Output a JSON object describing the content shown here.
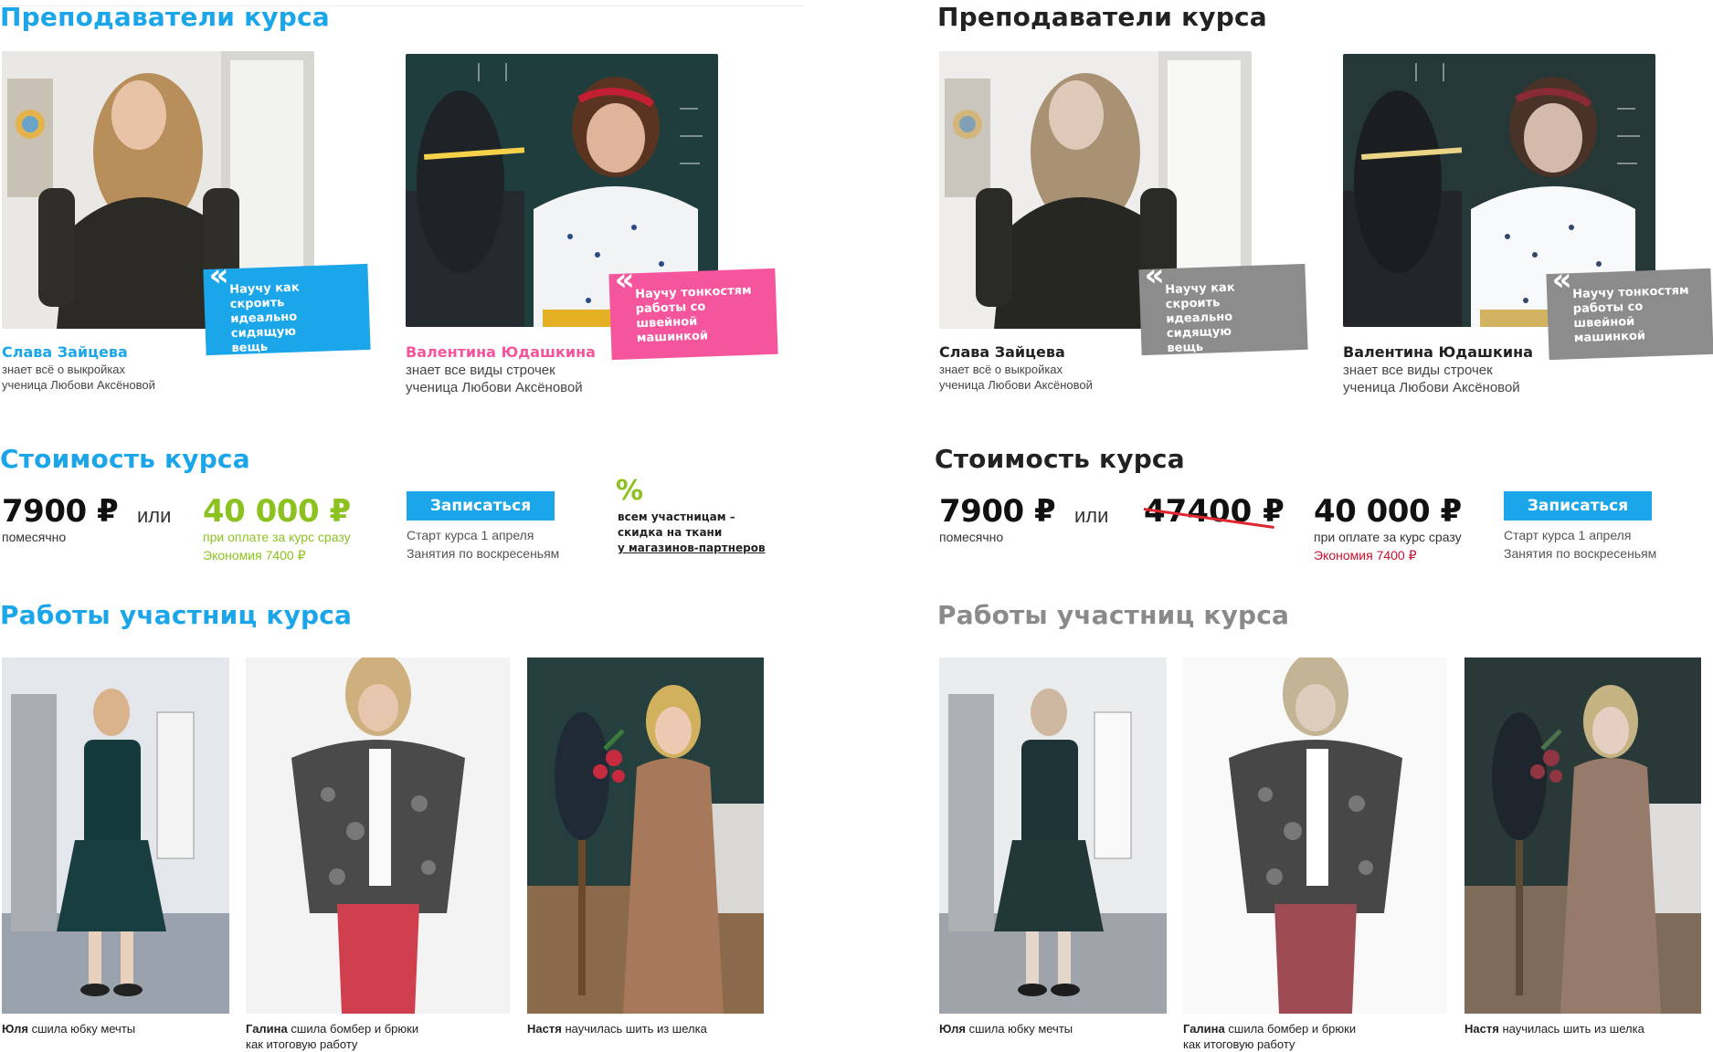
{
  "colors": {
    "blue_accent": "#1ca6ea",
    "pink_accent": "#f5559c",
    "green_accent": "#8cc21f",
    "gray_badge": "#8c8c8c",
    "dark_title": "#222222",
    "gray_title": "#8a8a8a",
    "red_economy": "#c8102e"
  },
  "left": {
    "teachers_title": "Преподаватели курса",
    "teachers": [
      {
        "name": "Слава Зайцева",
        "desc_line1": "знает всё о выкройках",
        "desc_line2": "ученица Любови Аксёновой",
        "quote_line1": "Научу как скроить",
        "quote_line2": "идеально сидящую",
        "quote_line3": "вещь"
      },
      {
        "name": "Валентина Юдашкина",
        "desc_line1": "знает все виды строчек",
        "desc_line2": "ученица Любови Аксёновой",
        "quote_line1": "Научу тонкостям",
        "quote_line2": "работы со швейной",
        "quote_line3": "машинкой"
      }
    ],
    "price_title": "Стоимость курса",
    "monthly_price": "7900 ₽",
    "monthly_label": "помесячно",
    "or_label": "или",
    "full_price": "40 000 ₽",
    "full_label": "при оплате за курс сразу",
    "economy": "Экономия 7400 ₽",
    "signup_label": "Записаться",
    "start_info": "Старт курса 1 апреля",
    "schedule_info": "Занятия по воскресеньям",
    "promo_icon": "%",
    "promo_line1": "всем участницам –",
    "promo_line2": "скидка на ткани",
    "promo_line3": "у магазинов-партнеров",
    "works_title": "Работы участниц курса",
    "works": [
      {
        "author": "Юля",
        "text": "сшила юбку мечты",
        "text2": ""
      },
      {
        "author": "Галина",
        "text": "сшила бомбер и брюки",
        "text2": "как итоговую работу"
      },
      {
        "author": "Настя",
        "text": "научилась шить из шелка",
        "text2": ""
      }
    ]
  },
  "right": {
    "teachers_title": "Преподаватели курса",
    "teachers": [
      {
        "name": "Слава Зайцева",
        "desc_line1": "знает всё о выкройках",
        "desc_line2": "ученица Любови Аксёновой",
        "quote_line1": "Научу как скроить",
        "quote_line2": "идеально сидящую",
        "quote_line3": "вещь"
      },
      {
        "name": "Валентина Юдашкина",
        "desc_line1": "знает все виды строчек",
        "desc_line2": "ученица Любови Аксёновой",
        "quote_line1": "Научу тонкостям",
        "quote_line2": "работы со швейной",
        "quote_line3": "машинкой"
      }
    ],
    "price_title": "Стоимость курса",
    "monthly_price": "7900 ₽",
    "monthly_label": "помесячно",
    "or_label": "или",
    "old_price": "47400 ₽",
    "full_price": "40 000 ₽",
    "full_label": "при оплате за курс сразу",
    "economy": "Экономия 7400 ₽",
    "signup_label": "Записаться",
    "start_info": "Старт курса 1 апреля",
    "schedule_info": "Занятия по воскресеньям",
    "works_title": "Работы участниц курса",
    "works": [
      {
        "author": "Юля",
        "text": "сшила юбку мечты",
        "text2": ""
      },
      {
        "author": "Галина",
        "text": "сшила бомбер и брюки",
        "text2": "как итоговую работу"
      },
      {
        "author": "Настя",
        "text": "научилась шить из шелка",
        "text2": ""
      }
    ]
  }
}
